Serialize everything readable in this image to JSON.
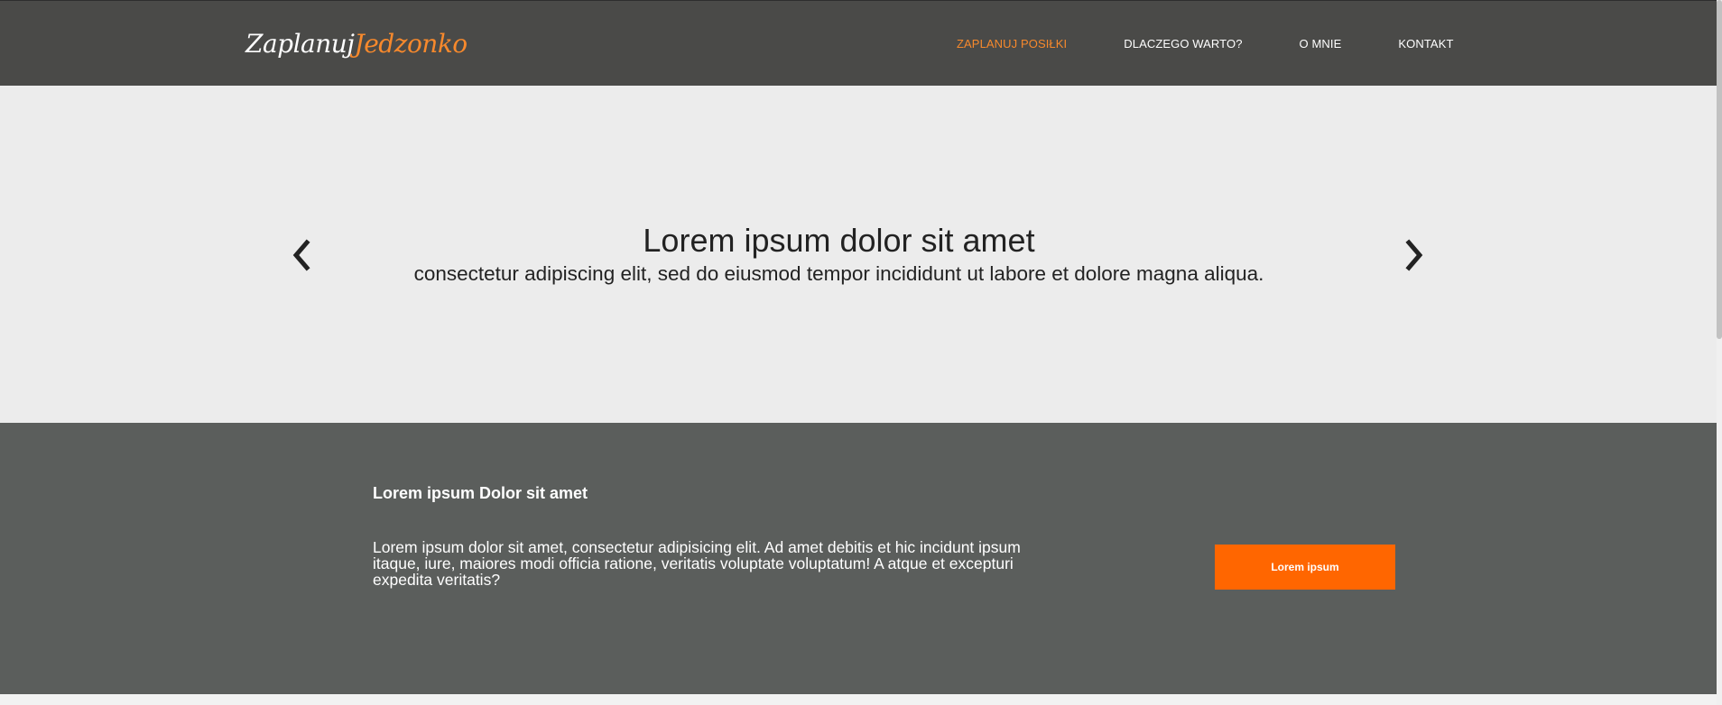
{
  "header": {
    "logo": {
      "part1": "Zaplanuj",
      "part2": "Jedzonko"
    },
    "nav": [
      {
        "label": "ZAPLANUJ POSIŁKI",
        "active": true
      },
      {
        "label": "DLACZEGO WARTO?",
        "active": false
      },
      {
        "label": "O MNIE",
        "active": false
      },
      {
        "label": "KONTAKT",
        "active": false
      }
    ]
  },
  "slider": {
    "title": "Lorem ipsum dolor sit amet",
    "subtitle": "consectetur adipiscing elit, sed do eiusmod tempor incididunt ut labore et dolore magna aliqua.",
    "prev_icon": "chevron-left-icon",
    "next_icon": "chevron-right-icon"
  },
  "cta": {
    "heading": "Lorem ipsum Dolor sit amet",
    "text": "Lorem ipsum dolor sit amet, consectetur adipisicing elit. Ad amet debitis et hic incidunt ipsum itaque, iure, maiores modi officia ratione, veritatis voluptate voluptatum! A atque et excepturi expedita veritatis?",
    "button_label": "Lorem ipsum"
  },
  "colors": {
    "header_bg": "#4a4a48",
    "accent_orange": "#f7892c",
    "button_orange": "#ff6600",
    "slider_bg": "#ececec",
    "cta_bg": "#5b5e5c"
  }
}
